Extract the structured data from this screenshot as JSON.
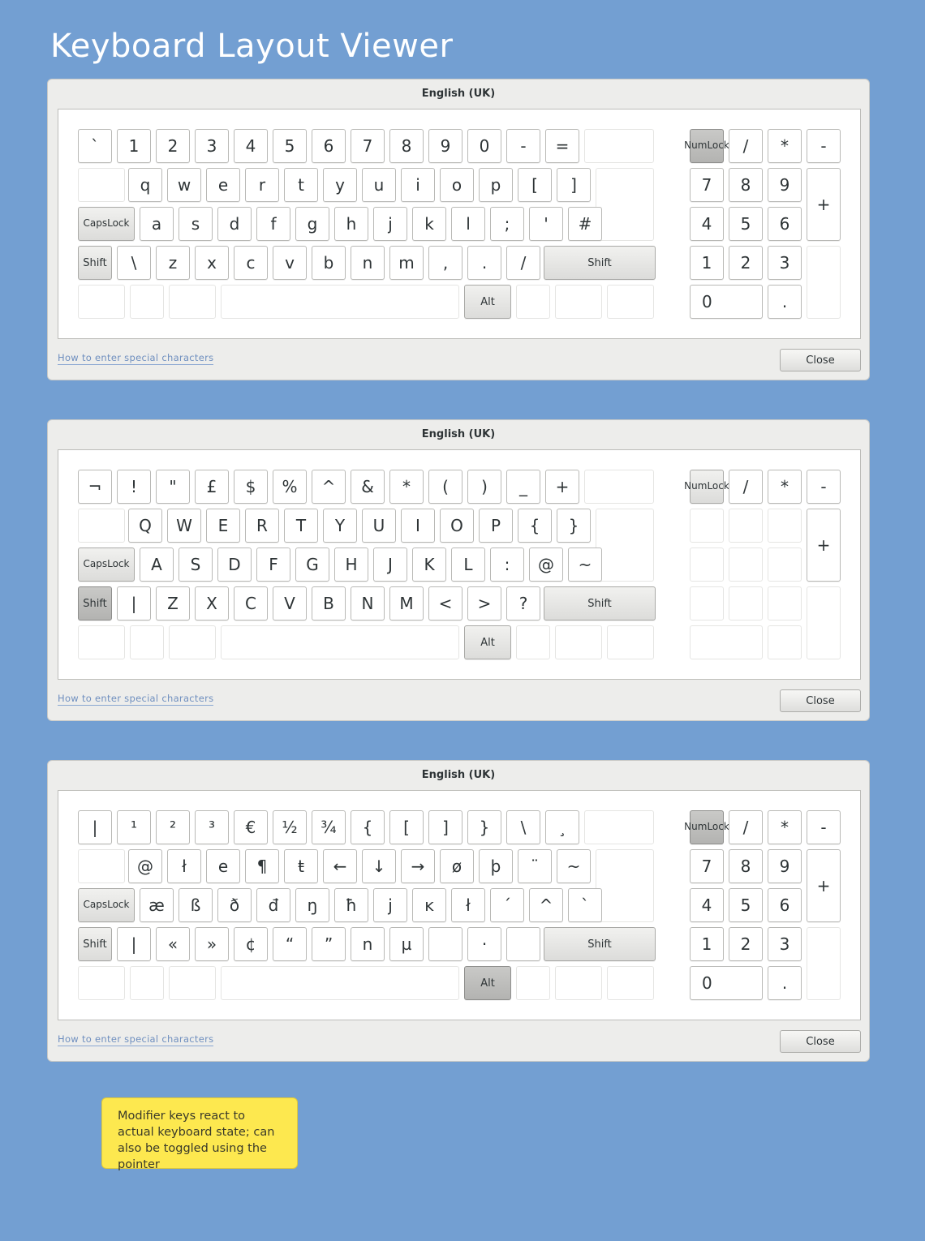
{
  "page_title": "Keyboard Layout Viewer",
  "note": "Modifier keys react to actual keyboard state; can also be toggled using the pointer",
  "modifiers": {
    "capslock": "CapsLock",
    "shift": "Shift",
    "alt": "Alt",
    "numlock_line1": "Num",
    "numlock_line2": "Lock"
  },
  "windows": [
    {
      "title": "English (UK)",
      "help_link": "How to enter special characters",
      "close_label": "Close",
      "pressed": [
        "numlock"
      ],
      "rows": {
        "number": [
          "`",
          "1",
          "2",
          "3",
          "4",
          "5",
          "6",
          "7",
          "8",
          "9",
          "0",
          "-",
          "="
        ],
        "top": [
          "q",
          "w",
          "e",
          "r",
          "t",
          "y",
          "u",
          "i",
          "o",
          "p",
          "[",
          "]"
        ],
        "home": [
          "a",
          "s",
          "d",
          "f",
          "g",
          "h",
          "j",
          "k",
          "l",
          ";",
          "'",
          "#"
        ],
        "bottom": [
          "\\",
          "z",
          "x",
          "c",
          "v",
          "b",
          "n",
          "m",
          ",",
          ".",
          "/"
        ]
      },
      "numpad": {
        "top": [
          "/",
          "*",
          "-"
        ],
        "r1": [
          "7",
          "8",
          "9"
        ],
        "plus": "+",
        "r2": [
          "4",
          "5",
          "6"
        ],
        "r3": [
          "1",
          "2",
          "3"
        ],
        "zero": "0",
        "dot": "."
      }
    },
    {
      "title": "English (UK)",
      "help_link": "How to enter special characters",
      "close_label": "Close",
      "pressed": [
        "shift"
      ],
      "rows": {
        "number": [
          "¬",
          "!",
          "\"",
          "£",
          "$",
          "%",
          "^",
          "&",
          "*",
          "(",
          ")",
          "_",
          "+"
        ],
        "top": [
          "Q",
          "W",
          "E",
          "R",
          "T",
          "Y",
          "U",
          "I",
          "O",
          "P",
          "{",
          "}"
        ],
        "home": [
          "A",
          "S",
          "D",
          "F",
          "G",
          "H",
          "J",
          "K",
          "L",
          ":",
          "@",
          "~"
        ],
        "bottom": [
          "|",
          "Z",
          "X",
          "C",
          "V",
          "B",
          "N",
          "M",
          "<",
          ">",
          "?"
        ]
      },
      "numpad": {
        "top": [
          "/",
          "*",
          "-"
        ],
        "r1": [
          "",
          "",
          ""
        ],
        "plus": "+",
        "r2": [
          "",
          "",
          ""
        ],
        "r3": [
          "",
          "",
          ""
        ],
        "zero": "",
        "dot": ""
      }
    },
    {
      "title": "English (UK)",
      "help_link": "How to enter special characters",
      "close_label": "Close",
      "pressed": [
        "numlock",
        "alt"
      ],
      "rows": {
        "number": [
          "|",
          "¹",
          "²",
          "³",
          "€",
          "½",
          "¾",
          "{",
          "[",
          "]",
          "}",
          "\\",
          "¸"
        ],
        "top": [
          "@",
          "ł",
          "e",
          "¶",
          "ŧ",
          "←",
          "↓",
          "→",
          "ø",
          "þ",
          "¨",
          "~"
        ],
        "home": [
          "æ",
          "ß",
          "ð",
          "đ",
          "ŋ",
          "ħ",
          "j",
          "ĸ",
          "ł",
          "´",
          "^",
          "`"
        ],
        "bottom": [
          "|",
          "«",
          "»",
          "¢",
          "“",
          "”",
          "n",
          "µ",
          "",
          "·",
          ""
        ]
      },
      "numpad": {
        "top": [
          "/",
          "*",
          "-"
        ],
        "r1": [
          "7",
          "8",
          "9"
        ],
        "plus": "+",
        "r2": [
          "4",
          "5",
          "6"
        ],
        "r3": [
          "1",
          "2",
          "3"
        ],
        "zero": "0",
        "dot": "."
      }
    }
  ]
}
